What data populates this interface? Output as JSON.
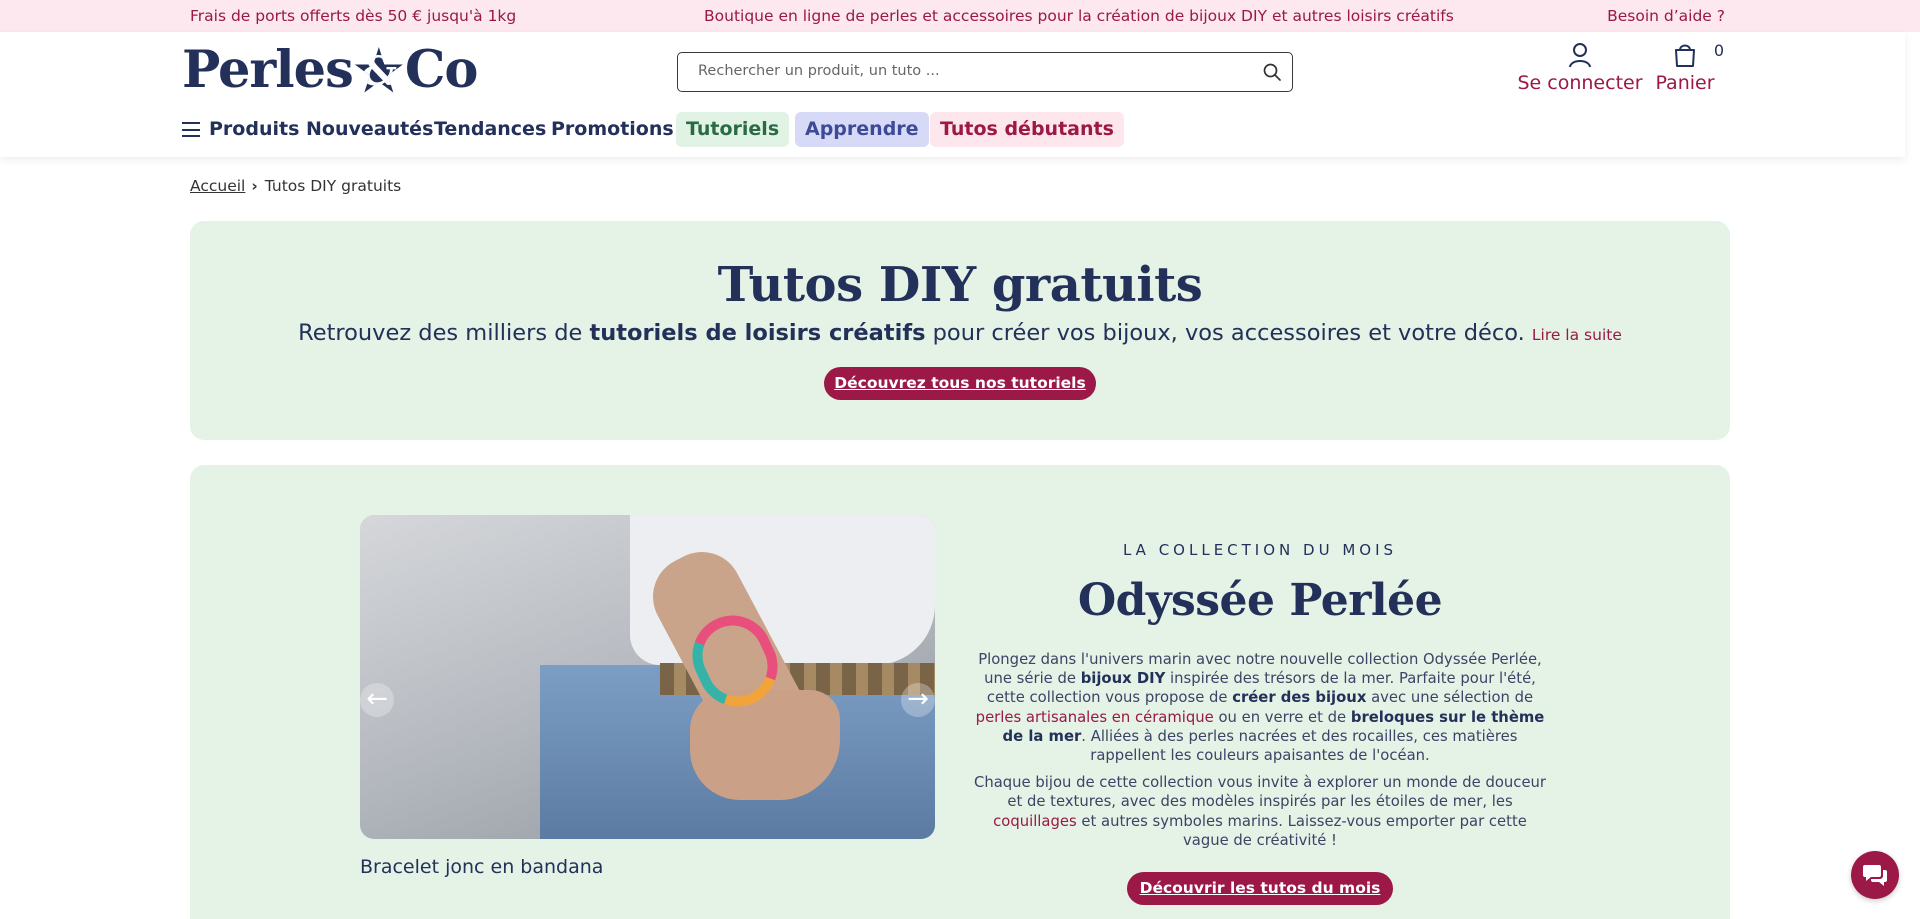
{
  "topbar": {
    "shipping": "Frais de ports offerts dès 50 € jusqu'à 1kg",
    "tagline": "Boutique en ligne de perles et accessoires pour la création de bijoux DIY et autres loisirs créatifs",
    "help": "Besoin d’aide ?"
  },
  "header": {
    "logo_left": "Perles",
    "logo_amp": "&",
    "logo_right": "Co",
    "search_placeholder": "Rechercher un produit, un tuto ...",
    "account_label": "Se connecter",
    "cart_label": "Panier",
    "cart_count": "0"
  },
  "nav": {
    "items": [
      {
        "label": "Produits"
      },
      {
        "label": "Nouveautés"
      },
      {
        "label": "Tendances"
      },
      {
        "label": "Promotions"
      },
      {
        "label": "Tutoriels"
      },
      {
        "label": "Apprendre"
      },
      {
        "label": "Tutos débutants"
      }
    ]
  },
  "breadcrumb": {
    "home": "Accueil",
    "current": "Tutos DIY gratuits"
  },
  "hero": {
    "title": "Tutos DIY gratuits",
    "lead_before": "Retrouvez des milliers de ",
    "lead_bold": "tutoriels de loisirs créatifs",
    "lead_after": " pour créer vos bijoux, vos accessoires et votre déco.",
    "read_more": "Lire la suite",
    "cta": "Découvrez tous nos tutoriels"
  },
  "collection": {
    "kicker": "LA COLLECTION DU MOIS",
    "title": "Odyssée Perlée",
    "caption": "Bracelet jonc en bandana",
    "p1": [
      {
        "t": "Plongez dans l'univers marin avec notre nouvelle collection Odyssée Perlée, une série de "
      },
      {
        "t": "bijoux DIY",
        "b": true
      },
      {
        "t": " inspirée des trésors de la mer. Parfaite pour l'été, cette collection vous propose de "
      },
      {
        "t": "créer des bijoux",
        "b": true
      },
      {
        "t": " avec une sélection de "
      },
      {
        "t": "perles artisanales en céramique",
        "link": true
      },
      {
        "t": " ou en verre et de "
      },
      {
        "t": "breloques sur le thème de la mer",
        "b": true
      },
      {
        "t": ". Alliées à des perles nacrées et des rocailles, ces matières rappellent les couleurs apaisantes de l'océan."
      }
    ],
    "p2": [
      {
        "t": "Chaque bijou de cette collection vous invite à explorer un monde de douceur et de textures, avec des modèles inspirés par les étoiles de mer, les "
      },
      {
        "t": "coquillages",
        "link": true
      },
      {
        "t": " et autres symboles marins. Laissez-vous emporter par cette vague de créativité !"
      }
    ],
    "cta": "Découvrir les tutos du mois",
    "arrow_left": "←",
    "arrow_right": "→"
  },
  "colors": {
    "brand_navy": "#23305a",
    "accent": "#9b1847",
    "mint": "#e4f3e6",
    "topbar_bg": "#fce8ee"
  },
  "icons": [
    "user-icon",
    "cart-icon",
    "search-icon",
    "menu-icon",
    "chevron-right-icon",
    "chat-icon"
  ]
}
